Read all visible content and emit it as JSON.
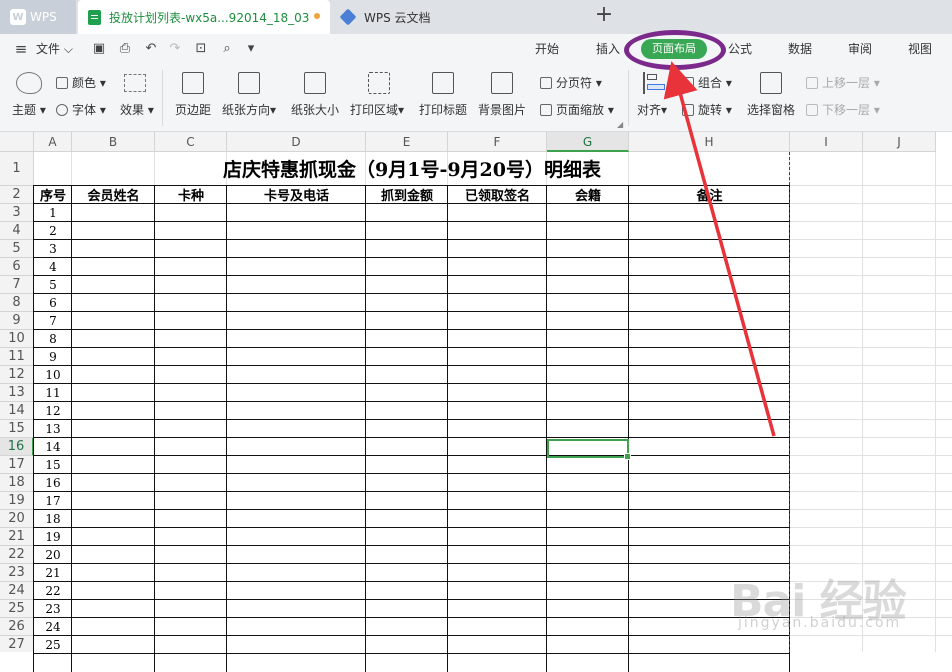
{
  "tabs": {
    "app": "WPS",
    "document": "投放计划列表-wx5a...92014_18_03",
    "cloud": "WPS 云文档"
  },
  "menu": {
    "file": "文件",
    "items": [
      "开始",
      "插入",
      "页面布局",
      "公式",
      "数据",
      "审阅",
      "视图"
    ],
    "active": "页面布局"
  },
  "ribbon": {
    "theme": "主题",
    "color": "颜色",
    "font": "字体",
    "effect": "效果",
    "margins": "页边距",
    "orientation": "纸张方向",
    "size": "纸张大小",
    "print_area": "打印区域",
    "print_titles": "打印标题",
    "background": "背景图片",
    "page_break": "分页符",
    "page_zoom": "页面缩放",
    "align": "对齐",
    "group": "组合",
    "rotate": "旋转",
    "selection_pane": "选择窗格",
    "bring_forward": "上移一层",
    "send_backward": "下移一层"
  },
  "columns": [
    "A",
    "B",
    "C",
    "D",
    "E",
    "F",
    "G",
    "H",
    "I",
    "J"
  ],
  "selected_column": "G",
  "selected_row": 16,
  "sheet": {
    "title": "店庆特惠抓现金（9月1号-9月20号）明细表",
    "headers": [
      "序号",
      "会员姓名",
      "卡种",
      "卡号及电话",
      "抓到金额",
      "已领取签名",
      "会籍",
      "备注"
    ],
    "row_numbers": [
      "1",
      "2",
      "3",
      "4",
      "5",
      "6",
      "7",
      "8",
      "9",
      "10",
      "11",
      "12",
      "13",
      "14",
      "15",
      "16",
      "17",
      "18",
      "19",
      "20",
      "21",
      "22",
      "23",
      "24",
      "25"
    ]
  },
  "watermark": {
    "brand": "Bai 经验",
    "url": "jingyan.baidu.com"
  },
  "colors": {
    "accent_green": "#39a854",
    "annotation_purple": "#7b2a8c",
    "arrow_red": "#e8333a"
  }
}
